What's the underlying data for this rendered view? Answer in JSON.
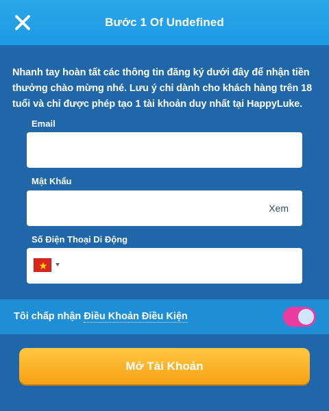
{
  "header": {
    "title": "Bước 1 Of Undefined",
    "close_icon": "close-icon"
  },
  "intro": {
    "text": "Nhanh tay hoàn tất các thông tin đăng ký dưới đây để nhận tiền thưởng chào mừng nhé. Lưu ý chỉ dành cho khách hàng trên 18 tuổi và chỉ được phép tạo 1 tài khoản duy nhất tại HappyLuke."
  },
  "form": {
    "email": {
      "label": "Email",
      "value": "",
      "placeholder": ""
    },
    "password": {
      "label": "Mật Khẩu",
      "value": "",
      "placeholder": "",
      "show_label": "Xem"
    },
    "phone": {
      "label": "Số Điện Thoại Di Động",
      "value": "",
      "placeholder": "",
      "country_flag": "vietnam-flag-icon"
    }
  },
  "terms": {
    "prefix": "Tôi chấp nhận ",
    "link": "Điều Khoản Điều Kiện",
    "toggle_on": true
  },
  "submit": {
    "label": "Mở Tài Khoản"
  },
  "colors": {
    "background": "#1f67a8",
    "header": "#1d9ae3",
    "terms_bar": "#1e8fd6",
    "toggle": "#ec3aa0",
    "button": "#f6a114"
  }
}
